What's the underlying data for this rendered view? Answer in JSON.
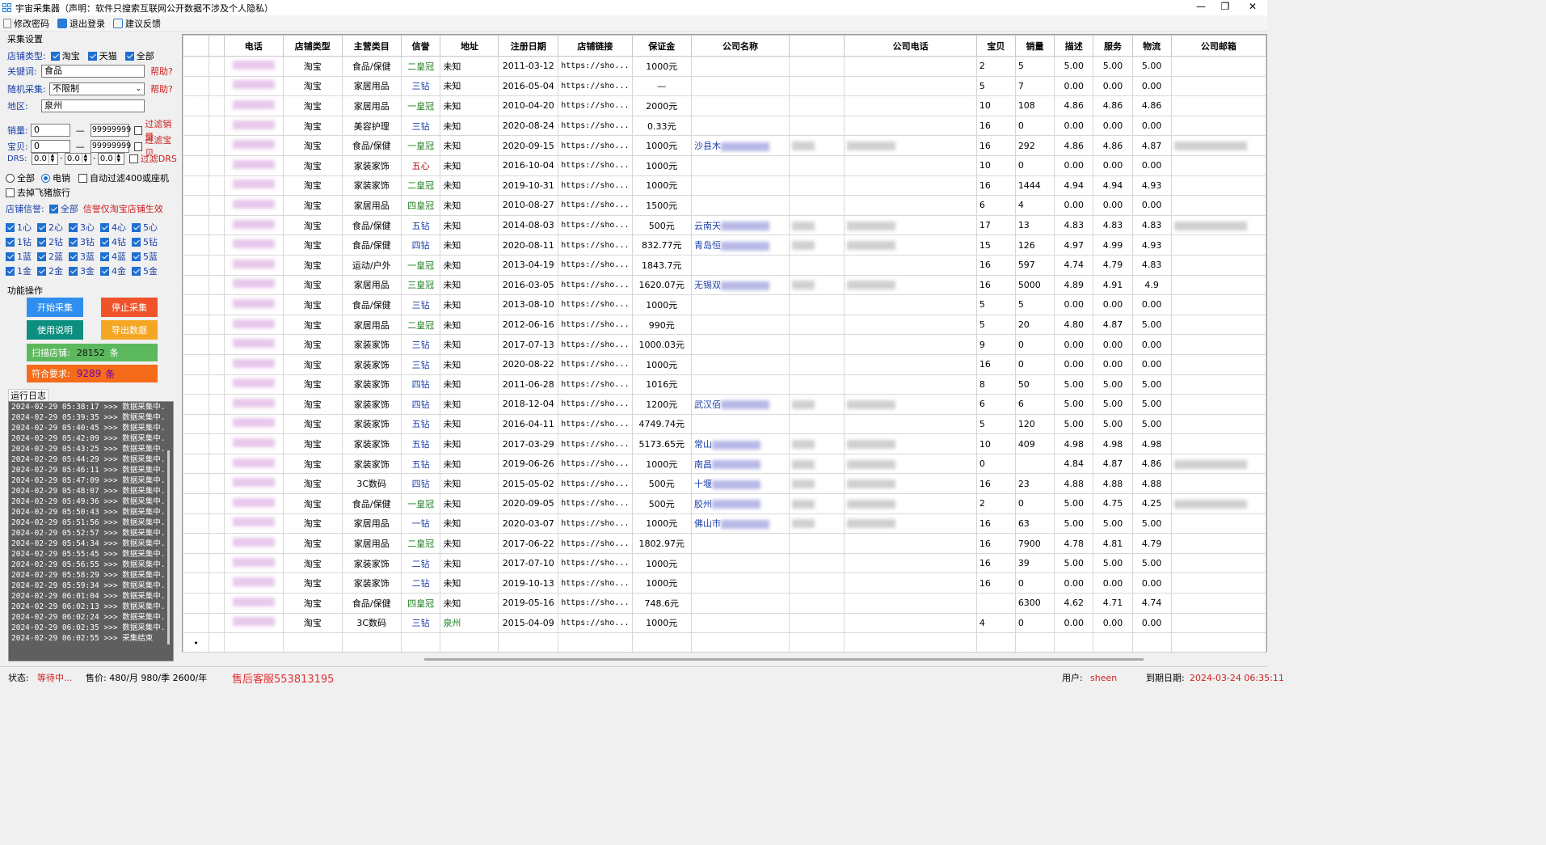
{
  "window": {
    "title": "宇宙采集器（声明：软件只搜索互联网公开数据不涉及个人隐私）",
    "minimize": "—",
    "maximize": "❐",
    "close": "✕"
  },
  "menu": [
    {
      "label": "修改密码",
      "icon": "key-icon"
    },
    {
      "label": "退出登录",
      "icon": "logout-icon"
    },
    {
      "label": "建议反馈",
      "icon": "edit-icon"
    }
  ],
  "settings": {
    "section_title": "采集设置",
    "shop_type_label": "店铺类型:",
    "shop_types": [
      "淘宝",
      "天猫",
      "全部"
    ],
    "keyword_label": "关键词:",
    "keyword_value": "食品",
    "help": "帮助?",
    "random_label": "随机采集:",
    "random_value": "不限制",
    "region_label": "地区:",
    "region_value": "泉州",
    "sales_label": "销量:",
    "sales_min": "0",
    "sales_max": "99999999",
    "filter_sales": "过滤销量",
    "items_label": "宝贝:",
    "items_min": "0",
    "items_max": "99999999",
    "filter_items": "过滤宝贝",
    "dsr_label": "DRS:",
    "dsr_values": [
      "0.0",
      "0.0",
      "0.0"
    ],
    "filter_dsr": "过滤DRS",
    "radio_all": "全部",
    "radio_ecom": "电销",
    "auto_filter": "自动过滤400或座机",
    "remove_fliggy": "去掉飞猪旅行",
    "credit_label": "店铺信誉:",
    "credit_all": "全部",
    "credit_note": "信誉仅淘宝店铺生效",
    "credit_rows": [
      [
        "1心",
        "2心",
        "3心",
        "4心",
        "5心"
      ],
      [
        "1钻",
        "2钻",
        "3钻",
        "4钻",
        "5钻"
      ],
      [
        "1蓝",
        "2蓝",
        "3蓝",
        "4蓝",
        "5蓝"
      ],
      [
        "1金",
        "2金",
        "3金",
        "4金",
        "5金"
      ]
    ],
    "dash": "—"
  },
  "actions": {
    "section_title": "功能操作",
    "start": "开始采集",
    "stop": "停止采集",
    "manual": "使用说明",
    "export": "导出数据",
    "scanned_label": "扫描店铺:",
    "scanned_value": "28152",
    "unit": "条",
    "matched_label": "符合要求:",
    "matched_value": "9289",
    "colors": {
      "start": "#2f8ff0",
      "stop": "#f0532a",
      "manual": "#0c8f7f",
      "export": "#f5a623",
      "scanned": "#5cb85c",
      "matched": "#f56b1a"
    }
  },
  "log": {
    "tab": "运行日志",
    "lines": [
      "2024-02-29 05:38:17 >>> 数据采集中...",
      "2024-02-29 05:39:35 >>> 数据采集中...",
      "2024-02-29 05:40:45 >>> 数据采集中...",
      "2024-02-29 05:42:09 >>> 数据采集中...",
      "2024-02-29 05:43:25 >>> 数据采集中...",
      "2024-02-29 05:44:29 >>> 数据采集中...",
      "2024-02-29 05:46:11 >>> 数据采集中...",
      "2024-02-29 05:47:09 >>> 数据采集中...",
      "2024-02-29 05:48:07 >>> 数据采集中...",
      "2024-02-29 05:49:36 >>> 数据采集中...",
      "2024-02-29 05:50:43 >>> 数据采集中...",
      "2024-02-29 05:51:56 >>> 数据采集中...",
      "2024-02-29 05:52:57 >>> 数据采集中...",
      "2024-02-29 05:54:34 >>> 数据采集中...",
      "2024-02-29 05:55:45 >>> 数据采集中...",
      "2024-02-29 05:56:55 >>> 数据采集中...",
      "2024-02-29 05:58:29 >>> 数据采集中...",
      "2024-02-29 05:59:34 >>> 数据采集中...",
      "2024-02-29 06:01:04 >>> 数据采集中...",
      "2024-02-29 06:02:13 >>> 数据采集中...",
      "2024-02-29 06:02:24 >>> 数据采集中...",
      "2024-02-29 06:02:35 >>> 数据采集中...",
      "2024-02-29 06:02:55 >>> 采集结束"
    ]
  },
  "grid": {
    "columns": [
      "电话",
      "店铺类型",
      "主营类目",
      "信誉",
      "地址",
      "注册日期",
      "店铺链接",
      "保证金",
      "公司名称",
      "",
      "公司电话",
      "宝贝",
      "销量",
      "描述",
      "服务",
      "物流",
      "公司邮箱"
    ],
    "rows": [
      {
        "type": "淘宝",
        "cat": "食品/保健",
        "rep": "二皇冠",
        "rc": "green",
        "addr": "未知",
        "date": "2011-03-12",
        "link": "https://sho...",
        "dep": "1000元",
        "co": "",
        "items": "2",
        "sales": "5",
        "d": "5.00",
        "s": "5.00",
        "l": "5.00"
      },
      {
        "type": "淘宝",
        "cat": "家居用品",
        "rep": "三钻",
        "rc": "blue",
        "addr": "未知",
        "date": "2016-05-04",
        "link": "https://sho...",
        "dep": "—",
        "co": "",
        "items": "5",
        "sales": "7",
        "d": "0.00",
        "s": "0.00",
        "l": "0.00"
      },
      {
        "type": "淘宝",
        "cat": "家居用品",
        "rep": "一皇冠",
        "rc": "green",
        "addr": "未知",
        "date": "2010-04-20",
        "link": "https://sho...",
        "dep": "2000元",
        "co": "",
        "items": "10",
        "sales": "108",
        "d": "4.86",
        "s": "4.86",
        "l": "4.86"
      },
      {
        "type": "淘宝",
        "cat": "美容护理",
        "rep": "三钻",
        "rc": "blue",
        "addr": "未知",
        "date": "2020-08-24",
        "link": "https://sho...",
        "dep": "0.33元",
        "co": "",
        "items": "16",
        "sales": "0",
        "d": "0.00",
        "s": "0.00",
        "l": "0.00"
      },
      {
        "type": "淘宝",
        "cat": "食品/保健",
        "rep": "一皇冠",
        "rc": "green",
        "addr": "未知",
        "date": "2020-09-15",
        "link": "https://sho...",
        "dep": "1000元",
        "co": "沙县木",
        "items": "16",
        "sales": "292",
        "d": "4.86",
        "s": "4.86",
        "l": "4.87"
      },
      {
        "type": "淘宝",
        "cat": "家装家饰",
        "rep": "五心",
        "rc": "red",
        "addr": "未知",
        "date": "2016-10-04",
        "link": "https://sho...",
        "dep": "1000元",
        "co": "",
        "items": "10",
        "sales": "0",
        "d": "0.00",
        "s": "0.00",
        "l": "0.00"
      },
      {
        "type": "淘宝",
        "cat": "家装家饰",
        "rep": "二皇冠",
        "rc": "green",
        "addr": "未知",
        "date": "2019-10-31",
        "link": "https://sho...",
        "dep": "1000元",
        "co": "",
        "items": "16",
        "sales": "1444",
        "d": "4.94",
        "s": "4.94",
        "l": "4.93"
      },
      {
        "type": "淘宝",
        "cat": "家居用品",
        "rep": "四皇冠",
        "rc": "green",
        "addr": "未知",
        "date": "2010-08-27",
        "link": "https://sho...",
        "dep": "1500元",
        "co": "",
        "items": "6",
        "sales": "4",
        "d": "0.00",
        "s": "0.00",
        "l": "0.00"
      },
      {
        "type": "淘宝",
        "cat": "食品/保健",
        "rep": "五钻",
        "rc": "blue",
        "addr": "未知",
        "date": "2014-08-03",
        "link": "https://sho...",
        "dep": "500元",
        "co": "云南天",
        "items": "17",
        "sales": "13",
        "d": "4.83",
        "s": "4.83",
        "l": "4.83"
      },
      {
        "type": "淘宝",
        "cat": "食品/保健",
        "rep": "四钻",
        "rc": "blue",
        "addr": "未知",
        "date": "2020-08-11",
        "link": "https://sho...",
        "dep": "832.77元",
        "co": "青岛恒",
        "items": "15",
        "sales": "126",
        "d": "4.97",
        "s": "4.99",
        "l": "4.93"
      },
      {
        "type": "淘宝",
        "cat": "运动/户外",
        "rep": "一皇冠",
        "rc": "green",
        "addr": "未知",
        "date": "2013-04-19",
        "link": "https://sho...",
        "dep": "1843.7元",
        "co": "",
        "items": "16",
        "sales": "597",
        "d": "4.74",
        "s": "4.79",
        "l": "4.83"
      },
      {
        "type": "淘宝",
        "cat": "家居用品",
        "rep": "三皇冠",
        "rc": "green",
        "addr": "未知",
        "date": "2016-03-05",
        "link": "https://sho...",
        "dep": "1620.07元",
        "co": "无锡双",
        "items": "16",
        "sales": "5000",
        "d": "4.89",
        "s": "4.91",
        "l": "4.9"
      },
      {
        "type": "淘宝",
        "cat": "食品/保健",
        "rep": "三钻",
        "rc": "blue",
        "addr": "未知",
        "date": "2013-08-10",
        "link": "https://sho...",
        "dep": "1000元",
        "co": "",
        "items": "5",
        "sales": "5",
        "d": "0.00",
        "s": "0.00",
        "l": "0.00"
      },
      {
        "type": "淘宝",
        "cat": "家居用品",
        "rep": "二皇冠",
        "rc": "green",
        "addr": "未知",
        "date": "2012-06-16",
        "link": "https://sho...",
        "dep": "990元",
        "co": "",
        "items": "5",
        "sales": "20",
        "d": "4.80",
        "s": "4.87",
        "l": "5.00"
      },
      {
        "type": "淘宝",
        "cat": "家装家饰",
        "rep": "三钻",
        "rc": "blue",
        "addr": "未知",
        "date": "2017-07-13",
        "link": "https://sho...",
        "dep": "1000.03元",
        "co": "",
        "items": "9",
        "sales": "0",
        "d": "0.00",
        "s": "0.00",
        "l": "0.00"
      },
      {
        "type": "淘宝",
        "cat": "家装家饰",
        "rep": "三钻",
        "rc": "blue",
        "addr": "未知",
        "date": "2020-08-22",
        "link": "https://sho...",
        "dep": "1000元",
        "co": "",
        "items": "16",
        "sales": "0",
        "d": "0.00",
        "s": "0.00",
        "l": "0.00"
      },
      {
        "type": "淘宝",
        "cat": "家装家饰",
        "rep": "四钻",
        "rc": "blue",
        "addr": "未知",
        "date": "2011-06-28",
        "link": "https://sho...",
        "dep": "1016元",
        "co": "",
        "items": "8",
        "sales": "50",
        "d": "5.00",
        "s": "5.00",
        "l": "5.00"
      },
      {
        "type": "淘宝",
        "cat": "家装家饰",
        "rep": "四钻",
        "rc": "blue",
        "addr": "未知",
        "date": "2018-12-04",
        "link": "https://sho...",
        "dep": "1200元",
        "co": "武汉佰",
        "items": "6",
        "sales": "6",
        "d": "5.00",
        "s": "5.00",
        "l": "5.00"
      },
      {
        "type": "淘宝",
        "cat": "家装家饰",
        "rep": "五钻",
        "rc": "blue",
        "addr": "未知",
        "date": "2016-04-11",
        "link": "https://sho...",
        "dep": "4749.74元",
        "co": "",
        "items": "5",
        "sales": "120",
        "d": "5.00",
        "s": "5.00",
        "l": "5.00"
      },
      {
        "type": "淘宝",
        "cat": "家装家饰",
        "rep": "五钻",
        "rc": "blue",
        "addr": "未知",
        "date": "2017-03-29",
        "link": "https://sho...",
        "dep": "5173.65元",
        "co": "常山",
        "items": "10",
        "sales": "409",
        "d": "4.98",
        "s": "4.98",
        "l": "4.98"
      },
      {
        "type": "淘宝",
        "cat": "家装家饰",
        "rep": "五钻",
        "rc": "blue",
        "addr": "未知",
        "date": "2019-06-26",
        "link": "https://sho...",
        "dep": "1000元",
        "co": "南昌",
        "items": "0",
        "sales": "",
        "d": "4.84",
        "s": "4.87",
        "l": "4.86"
      },
      {
        "type": "淘宝",
        "cat": "3C数码",
        "rep": "四钻",
        "rc": "blue",
        "addr": "未知",
        "date": "2015-05-02",
        "link": "https://sho...",
        "dep": "500元",
        "co": "十堰",
        "items": "16",
        "sales": "23",
        "d": "4.88",
        "s": "4.88",
        "l": "4.88"
      },
      {
        "type": "淘宝",
        "cat": "食品/保健",
        "rep": "一皇冠",
        "rc": "green",
        "addr": "未知",
        "date": "2020-09-05",
        "link": "https://sho...",
        "dep": "500元",
        "co": "胶州",
        "items": "2",
        "sales": "0",
        "d": "5.00",
        "s": "4.75",
        "l": "4.25"
      },
      {
        "type": "淘宝",
        "cat": "家居用品",
        "rep": "一钻",
        "rc": "blue",
        "addr": "未知",
        "date": "2020-03-07",
        "link": "https://sho...",
        "dep": "1000元",
        "co": "佛山市",
        "items": "16",
        "sales": "63",
        "d": "5.00",
        "s": "5.00",
        "l": "5.00"
      },
      {
        "type": "淘宝",
        "cat": "家居用品",
        "rep": "二皇冠",
        "rc": "green",
        "addr": "未知",
        "date": "2017-06-22",
        "link": "https://sho...",
        "dep": "1802.97元",
        "co": "",
        "items": "16",
        "sales": "7900",
        "d": "4.78",
        "s": "4.81",
        "l": "4.79"
      },
      {
        "type": "淘宝",
        "cat": "家装家饰",
        "rep": "二钻",
        "rc": "blue",
        "addr": "未知",
        "date": "2017-07-10",
        "link": "https://sho...",
        "dep": "1000元",
        "co": "",
        "items": "16",
        "sales": "39",
        "d": "5.00",
        "s": "5.00",
        "l": "5.00"
      },
      {
        "type": "淘宝",
        "cat": "家装家饰",
        "rep": "二钻",
        "rc": "blue",
        "addr": "未知",
        "date": "2019-10-13",
        "link": "https://sho...",
        "dep": "1000元",
        "co": "",
        "items": "16",
        "sales": "0",
        "d": "0.00",
        "s": "0.00",
        "l": "0.00"
      },
      {
        "type": "淘宝",
        "cat": "食品/保健",
        "rep": "四皇冠",
        "rc": "green",
        "addr": "未知",
        "date": "2019-05-16",
        "link": "https://sho...",
        "dep": "748.6元",
        "co": "",
        "items": "",
        "sales": "6300",
        "d": "4.62",
        "s": "4.71",
        "l": "4.74"
      },
      {
        "type": "淘宝",
        "cat": "3C数码",
        "rep": "三钻",
        "rc": "blue",
        "addr": "泉州",
        "date": "2015-04-09",
        "link": "https://sho...",
        "dep": "1000元",
        "co": "",
        "items": "4",
        "sales": "0",
        "d": "0.00",
        "s": "0.00",
        "l": "0.00"
      }
    ],
    "new_row_marker": "•"
  },
  "status": {
    "state_label": "状态:",
    "state_value": "等待中...",
    "price": "售价: 480/月 980/季 2600/年",
    "support": "售后客服553813195",
    "user_label": "用户:",
    "user_value": "sheen",
    "expire_label": "到期日期:",
    "expire_value": "2024-03-24 06:35:11"
  }
}
